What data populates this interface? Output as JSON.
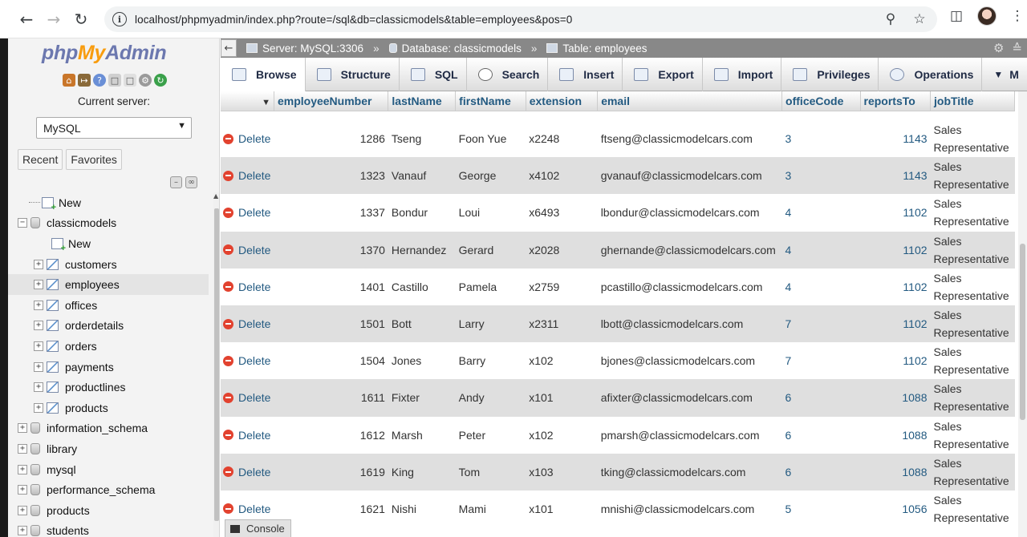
{
  "browser": {
    "url": "localhost/phpmyadmin/index.php?route=/sql&db=classicmodels&table=employees&pos=0"
  },
  "logo": {
    "part1": "php",
    "part2": "My",
    "part3": "Admin"
  },
  "nav": {
    "current_server_label": "Current server:",
    "server_value": "MySQL",
    "tabs": [
      "Recent",
      "Favorites"
    ],
    "tree": {
      "new": "New",
      "classicmodels": "classicmodels",
      "classicmodels_new": "New",
      "tables": [
        "customers",
        "employees",
        "offices",
        "orderdetails",
        "orders",
        "payments",
        "productlines",
        "products"
      ],
      "databases": [
        "information_schema",
        "library",
        "mysql",
        "performance_schema",
        "products",
        "students"
      ]
    }
  },
  "breadcrumb": {
    "server": "Server: MySQL:3306",
    "database": "Database: classicmodels",
    "table": "Table: employees"
  },
  "tabs": [
    "Browse",
    "Structure",
    "SQL",
    "Search",
    "Insert",
    "Export",
    "Import",
    "Privileges",
    "Operations",
    "M"
  ],
  "grid": {
    "columns": [
      "employeeNumber",
      "lastName",
      "firstName",
      "extension",
      "email",
      "officeCode",
      "reportsTo",
      "jobTitle"
    ],
    "delete_label": "Delete",
    "rows": [
      {
        "employeeNumber": "1286",
        "lastName": "Tseng",
        "firstName": "Foon Yue",
        "extension": "x2248",
        "email": "ftseng@classicmodelcars.com",
        "officeCode": "3",
        "reportsTo": "1143",
        "jobTitle1": "Sales",
        "jobTitle2": "Representative"
      },
      {
        "employeeNumber": "1323",
        "lastName": "Vanauf",
        "firstName": "George",
        "extension": "x4102",
        "email": "gvanauf@classicmodelcars.com",
        "officeCode": "3",
        "reportsTo": "1143",
        "jobTitle1": "Sales",
        "jobTitle2": "Representative"
      },
      {
        "employeeNumber": "1337",
        "lastName": "Bondur",
        "firstName": "Loui",
        "extension": "x6493",
        "email": "lbondur@classicmodelcars.com",
        "officeCode": "4",
        "reportsTo": "1102",
        "jobTitle1": "Sales",
        "jobTitle2": "Representative"
      },
      {
        "employeeNumber": "1370",
        "lastName": "Hernandez",
        "firstName": "Gerard",
        "extension": "x2028",
        "email": "ghernande@classicmodelcars.com",
        "officeCode": "4",
        "reportsTo": "1102",
        "jobTitle1": "Sales",
        "jobTitle2": "Representative"
      },
      {
        "employeeNumber": "1401",
        "lastName": "Castillo",
        "firstName": "Pamela",
        "extension": "x2759",
        "email": "pcastillo@classicmodelcars.com",
        "officeCode": "4",
        "reportsTo": "1102",
        "jobTitle1": "Sales",
        "jobTitle2": "Representative"
      },
      {
        "employeeNumber": "1501",
        "lastName": "Bott",
        "firstName": "Larry",
        "extension": "x2311",
        "email": "lbott@classicmodelcars.com",
        "officeCode": "7",
        "reportsTo": "1102",
        "jobTitle1": "Sales",
        "jobTitle2": "Representative"
      },
      {
        "employeeNumber": "1504",
        "lastName": "Jones",
        "firstName": "Barry",
        "extension": "x102",
        "email": "bjones@classicmodelcars.com",
        "officeCode": "7",
        "reportsTo": "1102",
        "jobTitle1": "Sales",
        "jobTitle2": "Representative"
      },
      {
        "employeeNumber": "1611",
        "lastName": "Fixter",
        "firstName": "Andy",
        "extension": "x101",
        "email": "afixter@classicmodelcars.com",
        "officeCode": "6",
        "reportsTo": "1088",
        "jobTitle1": "Sales",
        "jobTitle2": "Representative"
      },
      {
        "employeeNumber": "1612",
        "lastName": "Marsh",
        "firstName": "Peter",
        "extension": "x102",
        "email": "pmarsh@classicmodelcars.com",
        "officeCode": "6",
        "reportsTo": "1088",
        "jobTitle1": "Sales",
        "jobTitle2": "Representative"
      },
      {
        "employeeNumber": "1619",
        "lastName": "King",
        "firstName": "Tom",
        "extension": "x103",
        "email": "tking@classicmodelcars.com",
        "officeCode": "6",
        "reportsTo": "1088",
        "jobTitle1": "Sales",
        "jobTitle2": "Representative"
      },
      {
        "employeeNumber": "1621",
        "lastName": "Nishi",
        "firstName": "Mami",
        "extension": "x101",
        "email": "mnishi@classicmodelcars.com",
        "officeCode": "5",
        "reportsTo": "1056",
        "jobTitle1": "Sales",
        "jobTitle2": "Representative"
      }
    ]
  },
  "console_label": "Console",
  "colors": {
    "link": "#235a81",
    "row_alt": "#dfdfdf",
    "delete_icon": "#e2422f",
    "logo_blue": "#6c78af",
    "logo_orange": "#f89c0e"
  }
}
